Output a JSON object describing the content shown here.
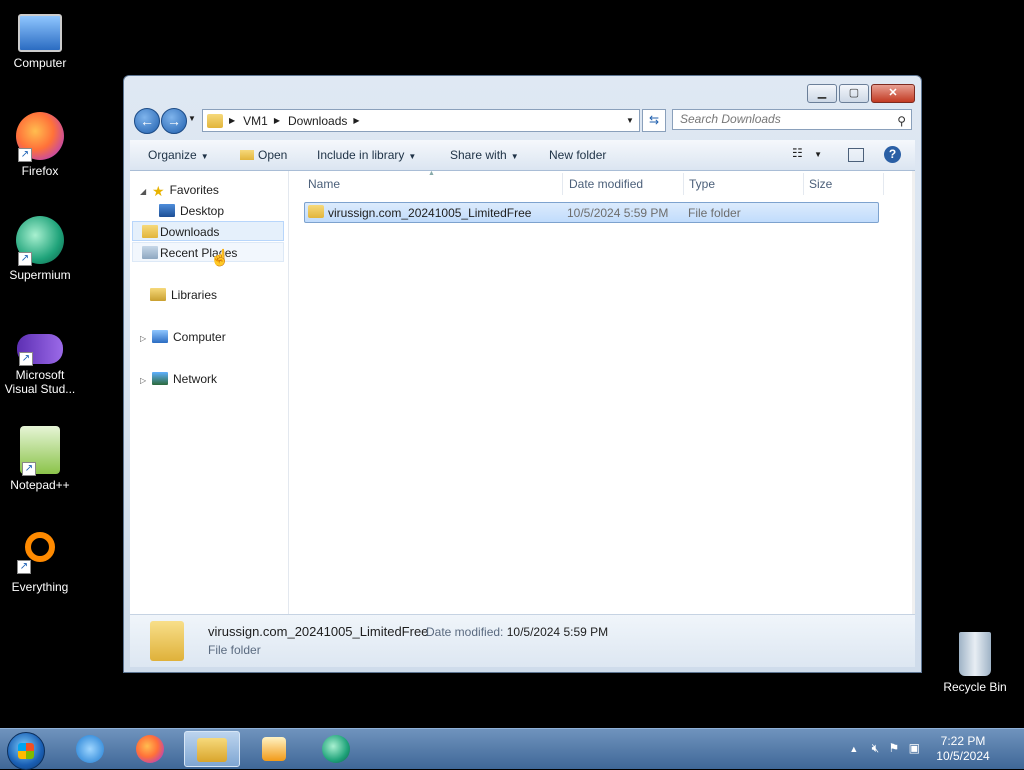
{
  "desktop": {
    "icons": [
      {
        "label": "Computer"
      },
      {
        "label": "Firefox"
      },
      {
        "label": "Supermium"
      },
      {
        "label": "Microsoft\nVisual Stud..."
      },
      {
        "label": "Notepad++"
      },
      {
        "label": "Everything"
      },
      {
        "label": "Recycle Bin"
      }
    ]
  },
  "window": {
    "address": {
      "crumbs": [
        "VM1",
        "Downloads"
      ]
    },
    "search_placeholder": "Search Downloads",
    "toolbar": {
      "organize": "Organize",
      "open": "Open",
      "include_in_library": "Include in library",
      "share_with": "Share with",
      "new_folder": "New folder"
    },
    "nav": {
      "favorites": "Favorites",
      "desktop": "Desktop",
      "downloads": "Downloads",
      "recent_places": "Recent Places",
      "libraries": "Libraries",
      "computer": "Computer",
      "network": "Network"
    },
    "columns": {
      "name": "Name",
      "date_modified": "Date modified",
      "type": "Type",
      "size": "Size"
    },
    "files": [
      {
        "name": "virussign.com_20241005_LimitedFree",
        "date": "10/5/2024 5:59 PM",
        "type": "File folder",
        "size": ""
      }
    ],
    "details": {
      "name": "virussign.com_20241005_LimitedFree",
      "date_label": "Date modified:",
      "date_value": "10/5/2024 5:59 PM",
      "type": "File folder"
    }
  },
  "taskbar": {
    "time": "7:22 PM",
    "date": "10/5/2024"
  }
}
